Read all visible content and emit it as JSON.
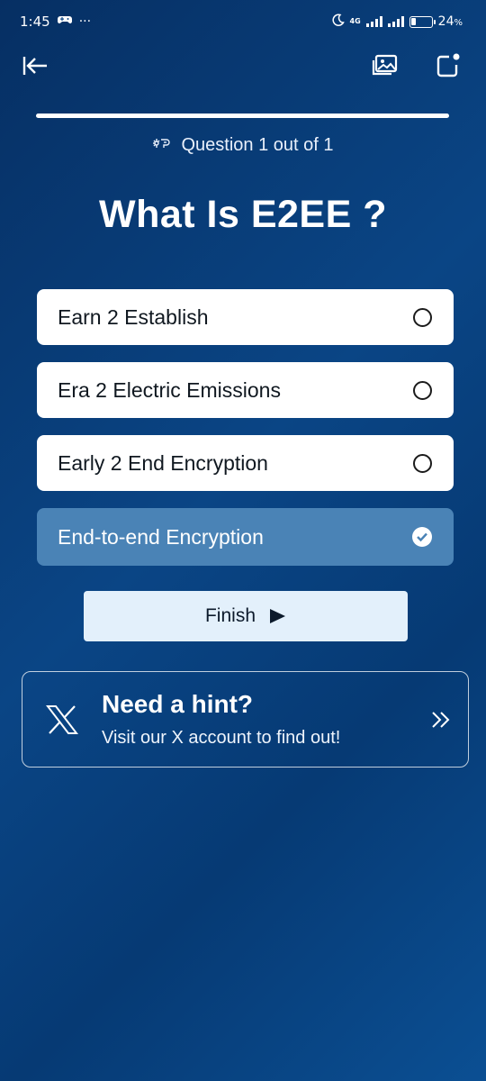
{
  "status_bar": {
    "time": "1:45",
    "more": "···",
    "network": "4G",
    "battery_percent": "24",
    "battery_suffix": "%",
    "battery_level": 0.24
  },
  "nav": {
    "icons": [
      "back-arrow-icon",
      "gallery-icon",
      "share-icon"
    ]
  },
  "quiz": {
    "progress": 1.0,
    "counter": "Question 1 out of 1",
    "question": "What Is E2EE ?",
    "options": [
      {
        "label": "Earn 2 Establish",
        "selected": false
      },
      {
        "label": "Era 2 Electric Emissions",
        "selected": false
      },
      {
        "label": "Early 2 End Encryption",
        "selected": false
      },
      {
        "label": "End-to-end Encryption",
        "selected": true
      }
    ],
    "finish_label": "Finish"
  },
  "hint": {
    "title": "Need a hint?",
    "subtitle": "Visit our X account to find out!"
  },
  "colors": {
    "background": "#0a4585",
    "selected_option": "#4a83b6",
    "finish_button": "#e3f0fb"
  }
}
